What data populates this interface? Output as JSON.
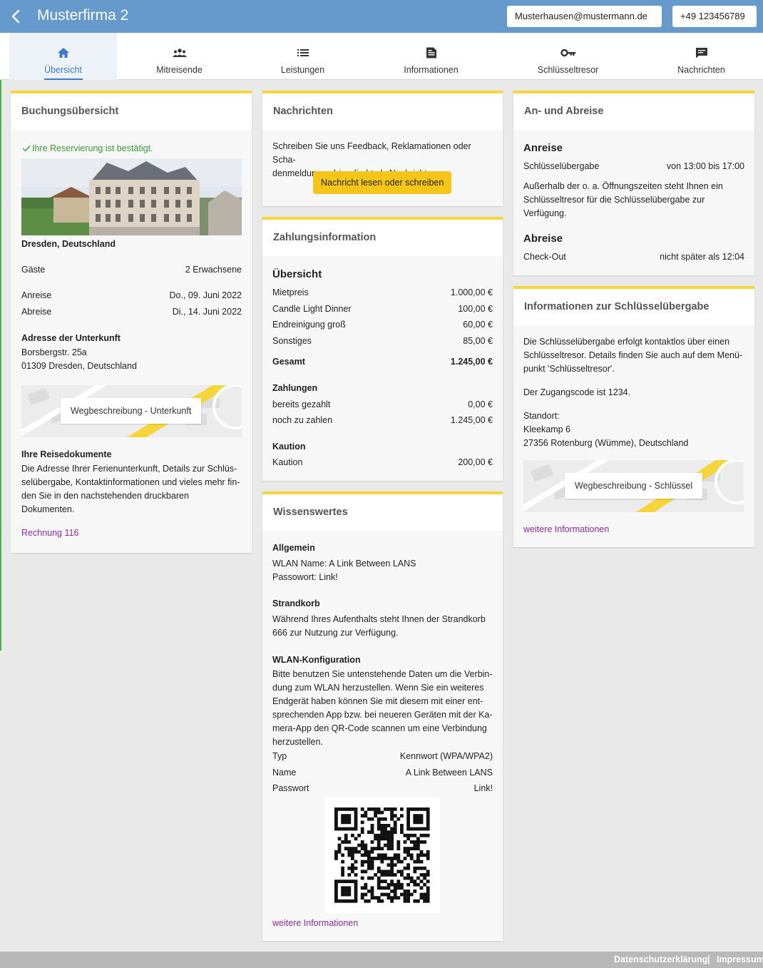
{
  "header": {
    "title": "Musterfirma 2",
    "email": "Musterhausen@mustermann.de",
    "phone": "+49 123456789"
  },
  "tabs": [
    {
      "label": "Übersicht",
      "icon": "home-icon"
    },
    {
      "label": "Mitreisende",
      "icon": "people-icon"
    },
    {
      "label": "Leistungen",
      "icon": "list-icon"
    },
    {
      "label": "Informationen",
      "icon": "document-icon"
    },
    {
      "label": "Schlüsseltresor",
      "icon": "key-icon"
    },
    {
      "label": "Nachrichten",
      "icon": "chat-icon"
    }
  ],
  "booking": {
    "title": "Buchungsübersicht",
    "confirmed": "Ihre Reservierung ist bestätigt.",
    "location": "Dresden, Deutschland",
    "guests_label": "Gäste",
    "guests_value": "2 Erwachsene",
    "arrival_label": "Anreise",
    "arrival_value": "Do., 09. Juni 2022",
    "departure_label": "Abreise",
    "departure_value": "Di., 14. Juni 2022",
    "address_title": "Adresse der Unterkunft",
    "address_line1": "Borsbergstr. 25a",
    "address_line2": "01309 Dresden, Deutschland",
    "map_button": "Wegbeschreibung - Unterkunft",
    "docs_title": "Ihre Reisedokumente",
    "docs_lines": [
      "Die Adresse Ihrer Ferienunterkunft, Details zur Schlüs-",
      "selübergabe, Kontaktinformationen und vieles mehr fin-",
      "den Sie in den nachstehenden druckbaren",
      "Dokumenten."
    ],
    "invoice_link": "Rechnung 116"
  },
  "messages": {
    "title": "Nachrichten",
    "text_lines": [
      "Schreiben Sie uns Feedback, Reklamationen oder Scha-",
      "denmeldungen hier direkt als Nachricht."
    ],
    "button": "Nachricht lesen oder schreiben"
  },
  "payment": {
    "title": "Zahlungsinformation",
    "overview_title": "Übersicht",
    "items": [
      {
        "label": "Mietpreis",
        "value": "1.000,00 €"
      },
      {
        "label": "Candle Light Dinner",
        "value": "100,00 €"
      },
      {
        "label": "Endreinigung groß",
        "value": "60,00 €"
      },
      {
        "label": "Sonstiges",
        "value": "85,00 €"
      }
    ],
    "total_label": "Gesamt",
    "total_value": "1.245,00 €",
    "payments_title": "Zahlungen",
    "paid_label": "bereits gezahlt",
    "paid_value": "0,00 €",
    "due_label": "noch zu zahlen",
    "due_value": "1.245,00 €",
    "deposit_title": "Kaution",
    "deposit_label": "Kaution",
    "deposit_value": "200,00 €"
  },
  "wissen": {
    "title": "Wissenswertes",
    "general_title": "Allgemein",
    "general_lines": [
      "WLAN Name: A Link Between LANS",
      "Passowort: Link!"
    ],
    "beach_title": "Strandkorb",
    "beach_lines": [
      "Während Ihres Aufenthalts steht Ihnen der Strandkorb",
      "666 zur Nutzung zur Verfügung."
    ],
    "wlan_title": "WLAN-Konfiguration",
    "wlan_lines": [
      "Bitte benutzen Sie untenstehende Daten um die Verbin-",
      "dung zum WLAN herzustellen. Wenn Sie ein weiteres",
      "Endgerät haben können Sie mit diesem mit einer ent-",
      "sprechenden App bzw. bei neueren Geräten mit der Ka-",
      "mera-App den QR-Code scannen um eine Verbindung",
      "herzustellen."
    ],
    "type_label": "Typ",
    "type_value": "Kennwort (WPA/WPA2)",
    "name_label": "Name",
    "name_value": "A Link Between LANS",
    "pass_label": "Passwort",
    "pass_value": "Link!",
    "more_link": "weitere Informationen"
  },
  "arrival": {
    "title": "An- und Abreise",
    "arr_title": "Anreise",
    "key_label": "Schlüsselübergabe",
    "key_value": "von 13:00 bis 17:00",
    "note_lines": [
      "Außerhalb der o. a. Öffnungszeiten steht Ihnen ein",
      "Schlüsseltresor für die Schlüsselübergabe zur",
      "Verfügung."
    ],
    "dep_title": "Abreise",
    "checkout_label": "Check-Out",
    "checkout_value": "nicht später als 12:04"
  },
  "keyinfo": {
    "title": "Informationen zur Schlüsselübergabe",
    "text_lines": [
      "Die Schlüsselübergabe erfolgt kontaktlos über einen",
      "Schlüsseltresor. Details finden Sie auch auf dem Menü-",
      "punkt 'Schlüsseltresor'."
    ],
    "code_text": "Der Zugangscode ist 1234.",
    "location_label": "Standort:",
    "location_line1": "Kleekamp 6",
    "location_line2": "27356 Rotenburg (Wümme), Deutschland",
    "map_button": "Wegbeschreibung - Schlüssel",
    "more_link": "weitere Informationen"
  },
  "footer": {
    "privacy": "Datenschutzerklärung",
    "separator": "|",
    "imprint": "Impressum"
  }
}
